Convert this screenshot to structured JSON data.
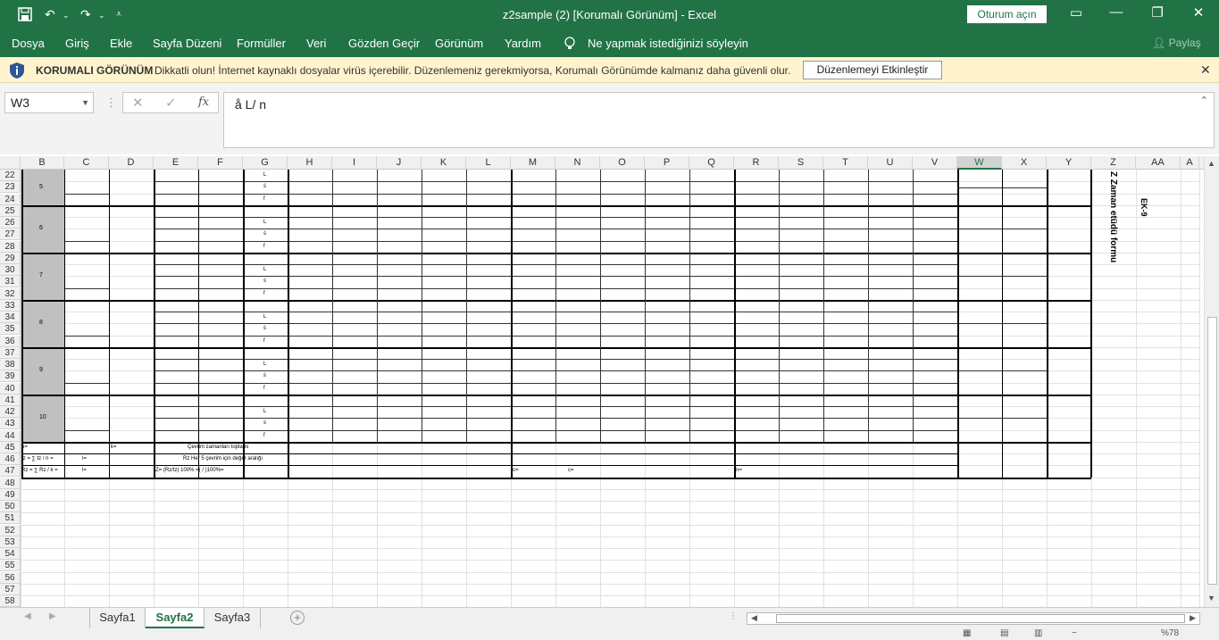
{
  "title_bar": {
    "title": "z2sample (2)  [Korumalı Görünüm]  -  Excel",
    "signin": "Oturum açın",
    "save_icon": "save-icon"
  },
  "menu": {
    "items": [
      "Dosya",
      "Giriş",
      "Ekle",
      "Sayfa Düzeni",
      "Formüller",
      "Veri",
      "Gözden Geçir",
      "Görünüm",
      "Yardım"
    ],
    "tell_me": "Ne yapmak istediğinizi söyleyin",
    "share": "Paylaş"
  },
  "protected_bar": {
    "label": "KORUMALI GÖRÜNÜM",
    "message": "Dikkatli olun! İnternet kaynaklı dosyalar virüs içerebilir. Düzenlemeniz gerekmiyorsa, Korumalı Görünümde kalmanız daha güvenli olur.",
    "button": "Düzenlemeyi Etkinleştir",
    "accent": "#fff4ce"
  },
  "formula_bar": {
    "name_box": "W3",
    "fx": "fx",
    "formula": "å L/ n"
  },
  "columns": [
    "B",
    "C",
    "D",
    "E",
    "F",
    "G",
    "H",
    "I",
    "J",
    "K",
    "L",
    "M",
    "N",
    "O",
    "P",
    "Q",
    "R",
    "S",
    "T",
    "U",
    "V",
    "W",
    "X",
    "Y",
    "Z",
    "AA",
    "A"
  ],
  "selected_column": "W",
  "rows": [
    "22",
    "23",
    "24",
    "25",
    "26",
    "27",
    "28",
    "29",
    "30",
    "31",
    "32",
    "33",
    "34",
    "35",
    "36",
    "37",
    "38",
    "39",
    "40",
    "41",
    "42",
    "43",
    "44",
    "45",
    "46",
    "47",
    "48",
    "49",
    "50",
    "51",
    "52",
    "53",
    "54",
    "55",
    "56",
    "57",
    "58"
  ],
  "groups": [
    "5",
    "6",
    "7",
    "8",
    "9",
    "10"
  ],
  "l_marks": [
    "L",
    "ś",
    "f"
  ],
  "sheet_text": {
    "r45_n": "n=",
    "r45_k": "k=",
    "r45_sum": "Çevrim zamanları toplamı",
    "r46_tz": "tz = ∑ tz / n =",
    "r46_eq": "l=",
    "r46_rz": "Rz Her 5 çevrim için değer aralığı",
    "r47_rz": "Rz = ∑ Rz / k =",
    "r47_eq": "l=",
    "r47_z": "Z= (Rz/tz) 100%     =(           /           )100%=",
    "r47_c1": "c=",
    "r47_c2": "c=",
    "r47_n": "n=",
    "vertical_title": "Z Zaman etüdü formu",
    "ek": "EK-9"
  },
  "tabs": [
    "Sayfa1",
    "Sayfa2",
    "Sayfa3"
  ],
  "active_tab": "Sayfa2",
  "zoom": "%78",
  "colors": {
    "excel_green": "#217346"
  }
}
